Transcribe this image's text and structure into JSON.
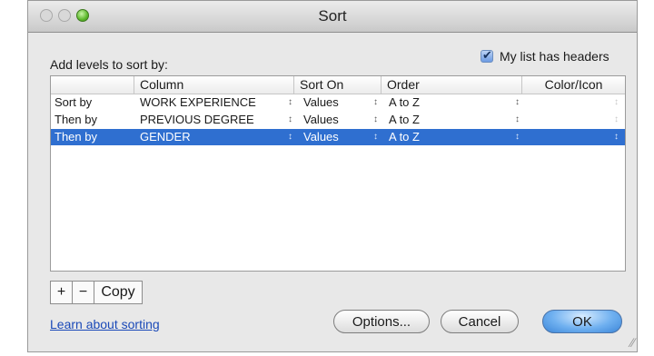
{
  "window": {
    "title": "Sort"
  },
  "dialog": {
    "add_levels_label": "Add levels to sort by:",
    "headers_checkbox_label": "My list has headers",
    "headers_checked": true
  },
  "grid": {
    "headers": [
      "Column",
      "Sort On",
      "Order",
      "Color/Icon"
    ],
    "rows": [
      {
        "prefix": "Sort by",
        "column": "WORK EXPERIENCE",
        "sort_on": "Values",
        "order": "A to Z",
        "selected": false
      },
      {
        "prefix": "Then by",
        "column": "PREVIOUS DEGREE",
        "sort_on": "Values",
        "order": "A to Z",
        "selected": false
      },
      {
        "prefix": "Then by",
        "column": "GENDER",
        "sort_on": "Values",
        "order": "A to Z",
        "selected": true
      }
    ]
  },
  "level_buttons": {
    "add": "+",
    "remove": "−",
    "copy": "Copy"
  },
  "footer": {
    "learn_link": "Learn about sorting",
    "options_button": "Options...",
    "cancel_button": "Cancel",
    "ok_button": "OK"
  },
  "colors": {
    "selection": "#2f6fd0",
    "link": "#1a49b8",
    "ok_button": "#6fb0f0"
  }
}
